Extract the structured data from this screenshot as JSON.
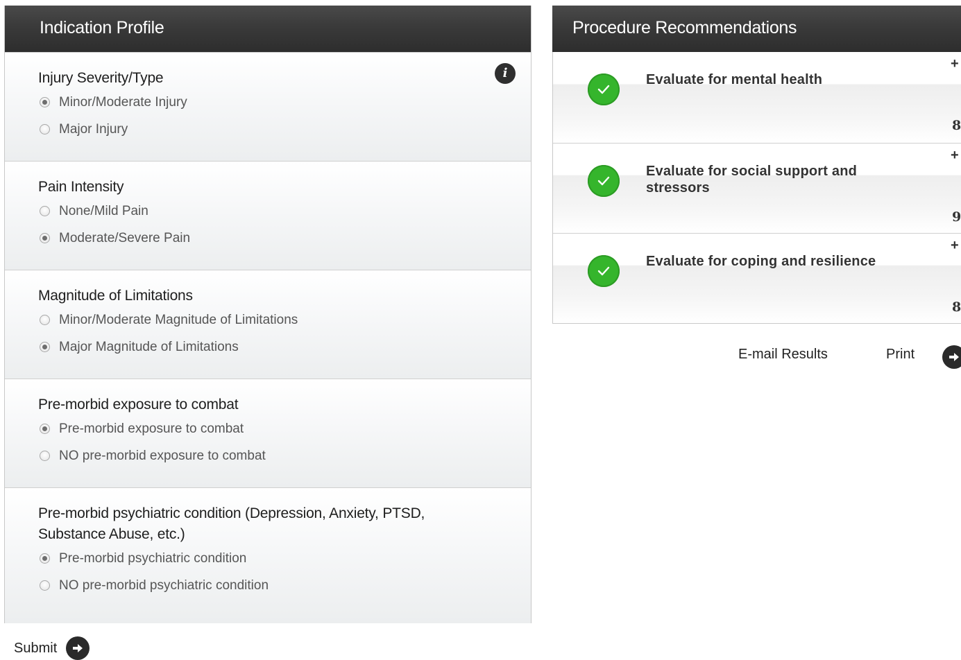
{
  "indication_panel": {
    "title": "Indication Profile",
    "info_icon": "info-icon",
    "sections": [
      {
        "title": "Injury Severity/Type",
        "options": [
          {
            "label": "Minor/Moderate Injury",
            "checked": true
          },
          {
            "label": "Major Injury",
            "checked": false
          }
        ]
      },
      {
        "title": "Pain Intensity",
        "options": [
          {
            "label": "None/Mild Pain",
            "checked": false
          },
          {
            "label": "Moderate/Severe Pain",
            "checked": true
          }
        ]
      },
      {
        "title": "Magnitude of Limitations",
        "options": [
          {
            "label": "Minor/Moderate Magnitude of Limitations",
            "checked": false
          },
          {
            "label": "Major Magnitude of Limitations",
            "checked": true
          }
        ]
      },
      {
        "title": "Pre-morbid exposure to combat",
        "options": [
          {
            "label": "Pre-morbid exposure to combat",
            "checked": true
          },
          {
            "label": "NO pre-morbid exposure to combat",
            "checked": false
          }
        ]
      },
      {
        "title": "Pre-morbid psychiatric condition (Depression, Anxiety, PTSD, Substance Abuse, etc.)",
        "options": [
          {
            "label": "Pre-morbid psychiatric condition",
            "checked": true
          },
          {
            "label": "NO pre-morbid psychiatric condition",
            "checked": false
          }
        ]
      }
    ]
  },
  "submit": {
    "label": "Submit",
    "icon": "arrow-right-circle-icon"
  },
  "recommendations_panel": {
    "title": "Procedure Recommendations",
    "items": [
      {
        "text": "Evaluate for mental health",
        "expand": "+",
        "count": "8",
        "icon": "check-circle-icon"
      },
      {
        "text": "Evaluate for social support and stressors",
        "expand": "+",
        "count": "9",
        "icon": "check-circle-icon"
      },
      {
        "text": "Evaluate for coping and resilience",
        "expand": "+",
        "count": "8",
        "icon": "check-circle-icon"
      }
    ],
    "actions": {
      "email_label": "E-mail Results",
      "print_label": "Print",
      "go_icon": "arrow-right-circle-icon"
    }
  },
  "colors": {
    "header_bg": "#333333",
    "check_green": "#35b52c",
    "arrow_button": "#2a2a2a"
  }
}
